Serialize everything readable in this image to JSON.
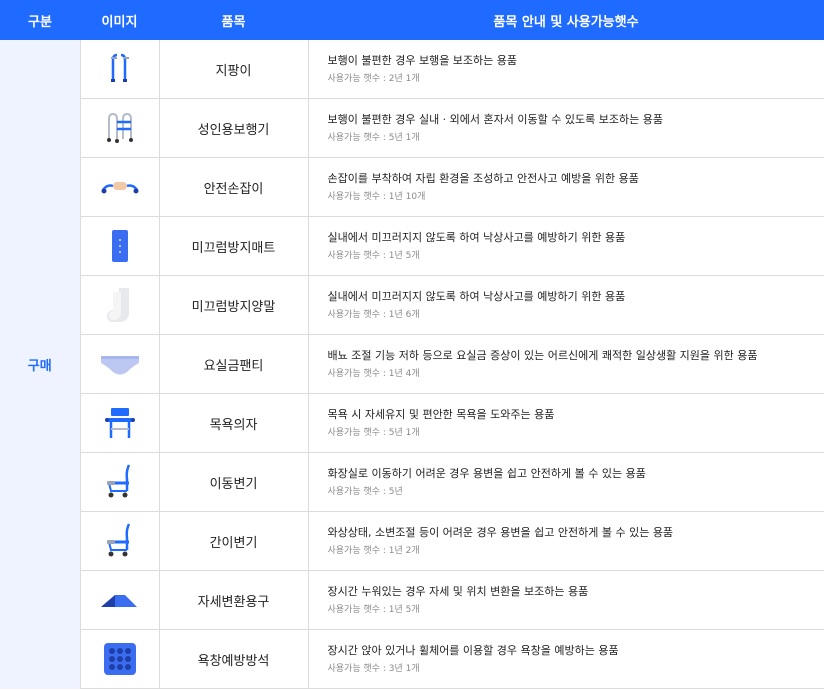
{
  "header": {
    "col_category": "구분",
    "col_image": "이미지",
    "col_item": "품목",
    "col_desc": "품목 안내 및 사용가능햇수"
  },
  "category": "구매",
  "rows": [
    {
      "icon": "cane-icon",
      "name": "지팡이",
      "desc": "보행이 불편한 경우 보행을 보조하는 용품",
      "usage": "사용가능 햇수 : 2년 1개"
    },
    {
      "icon": "walker-icon",
      "name": "성인용보행기",
      "desc": "보행이 불편한 경우 실내 · 외에서 혼자서 이동할 수 있도록 보조하는 용품",
      "usage": "사용가능 햇수 : 5년 1개"
    },
    {
      "icon": "safety-handle-icon",
      "name": "안전손잡이",
      "desc": "손잡이를 부착하여 자립 환경을 조성하고 안전사고 예방을 위한 용품",
      "usage": "사용가능 햇수 : 1년 10개"
    },
    {
      "icon": "anti-slip-mat-icon",
      "name": "미끄럼방지매트",
      "desc": "실내에서 미끄러지지 않도록 하여 낙상사고를 예방하기 위한 용품",
      "usage": "사용가능 햇수 : 1년 5개"
    },
    {
      "icon": "anti-slip-socks-icon",
      "name": "미끄럼방지양말",
      "desc": "실내에서 미끄러지지 않도록 하여 낙상사고를 예방하기 위한 용품",
      "usage": "사용가능 햇수 : 1년 6개"
    },
    {
      "icon": "incontinence-panty-icon",
      "name": "요실금팬티",
      "desc": "배뇨 조절 기능 저하 등으로 요실금 증상이 있는 어르신에게 쾌적한 일상생활 지원을 위한 용품",
      "usage": "사용가능 햇수 : 1년 4개"
    },
    {
      "icon": "bath-chair-icon",
      "name": "목욕의자",
      "desc": "목욕 시 자세유지 및 편안한 목욕을 도와주는 용품",
      "usage": "사용가능 햇수 : 5년 1개"
    },
    {
      "icon": "mobile-toilet-icon",
      "name": "이동변기",
      "desc": "화장실로 이동하기 어려운 경우 용변을 쉽고 안전하게 볼 수 있는 용품",
      "usage": "사용가능 햇수 : 5년"
    },
    {
      "icon": "simple-toilet-icon",
      "name": "간이변기",
      "desc": "와상상태, 소변조절 등이 어려운 경우 용변을 쉽고 안전하게 볼 수 있는 용품",
      "usage": "사용가능 햇수 : 1년 2개"
    },
    {
      "icon": "position-change-tool-icon",
      "name": "자세변환용구",
      "desc": "장시간 누워있는 경우 자세 및 위치 변환을 보조하는 용품",
      "usage": "사용가능 햇수 : 1년 5개"
    },
    {
      "icon": "bedsore-cushion-icon",
      "name": "욕창예방방석",
      "desc": "장시간 앉아 있거나 휠체어를 이용할 경우 욕창을 예방하는 용품",
      "usage": "사용가능 햇수 : 3년 1개"
    }
  ]
}
